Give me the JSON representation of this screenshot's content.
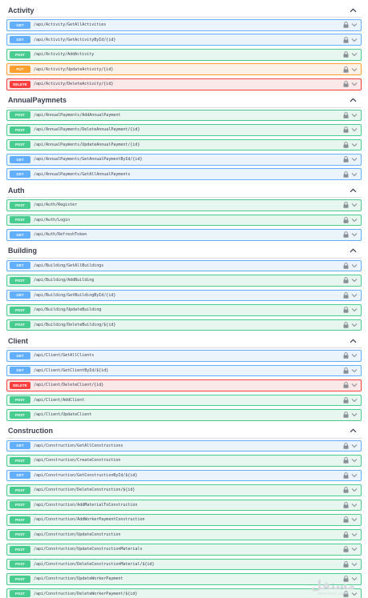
{
  "colors": {
    "get": "#61affe",
    "post": "#49cc90",
    "put": "#fca130",
    "delete": "#f93e3e"
  },
  "icons": {
    "lock": "lock-icon",
    "expand": "chevron-down-icon",
    "collapse": "chevron-up-icon"
  },
  "sections": [
    {
      "title": "Activity",
      "ops": [
        {
          "method": "GET",
          "path": "/api/Activity/GetAllActivities"
        },
        {
          "method": "GET",
          "path": "/api/Activity/GetActivityById/{id}"
        },
        {
          "method": "POST",
          "path": "/api/Activity/AddActivity"
        },
        {
          "method": "PUT",
          "path": "/api/Activity/UpdateActivity/{id}"
        },
        {
          "method": "DELETE",
          "path": "/api/Activity/DeleteActivity/{id}"
        }
      ]
    },
    {
      "title": "AnnualPaymnets",
      "ops": [
        {
          "method": "POST",
          "path": "/api/AnnualPayments/AddAnnualPayment"
        },
        {
          "method": "POST",
          "path": "/api/AnnualPayments/DeleteAnnualPayment/{id}"
        },
        {
          "method": "POST",
          "path": "/api/AnnualPayments/UpdateAnnualPayment/{id}"
        },
        {
          "method": "GET",
          "path": "/api/AnnualPayments/GetAnnualPaymentById/{id}"
        },
        {
          "method": "GET",
          "path": "/api/AnnualPayments/GetAllAnnualPayments"
        }
      ]
    },
    {
      "title": "Auth",
      "ops": [
        {
          "method": "POST",
          "path": "/api/Auth/Register"
        },
        {
          "method": "POST",
          "path": "/api/Auth/Login"
        },
        {
          "method": "GET",
          "path": "/api/Auth/RefreshToken"
        }
      ]
    },
    {
      "title": "Building",
      "ops": [
        {
          "method": "GET",
          "path": "/api/Building/GetAllBuildings"
        },
        {
          "method": "POST",
          "path": "/api/Building/AddBuilding"
        },
        {
          "method": "GET",
          "path": "/api/Building/GetBuildingById/{id}"
        },
        {
          "method": "POST",
          "path": "/api/Building/UpdateBuilding"
        },
        {
          "method": "POST",
          "path": "/api/Building/DeleteBuilding/${id}"
        }
      ]
    },
    {
      "title": "Client",
      "ops": [
        {
          "method": "GET",
          "path": "/api/Client/GetAllClients"
        },
        {
          "method": "GET",
          "path": "/api/Client/GetClientById/${id}"
        },
        {
          "method": "DELETE",
          "path": "/api/Client/DeleteClient/{id}"
        },
        {
          "method": "POST",
          "path": "/api/Client/AddClient"
        },
        {
          "method": "POST",
          "path": "/api/Client/UpdateClient"
        }
      ]
    },
    {
      "title": "Construction",
      "ops": [
        {
          "method": "GET",
          "path": "/api/Construction/GetAllConstructions"
        },
        {
          "method": "POST",
          "path": "/api/Construction/CreateConstruction"
        },
        {
          "method": "GET",
          "path": "/api/Construction/GetConstructionById/${id}"
        },
        {
          "method": "POST",
          "path": "/api/Construction/DeleteConstruction/${id}"
        },
        {
          "method": "POST",
          "path": "/api/Construction/AddMaterialToConstruction"
        },
        {
          "method": "POST",
          "path": "/api/Construction/AddWorkerPaymentConstruction"
        },
        {
          "method": "POST",
          "path": "/api/Construction/UpdateConstruction"
        },
        {
          "method": "POST",
          "path": "/api/Construction/UpdateConstructionMaterials"
        },
        {
          "method": "POST",
          "path": "/api/Construction/DeleteConstructionMaterial/${id}"
        },
        {
          "method": "POST",
          "path": "/api/Construction/UpdateWorkerPayment"
        },
        {
          "method": "POST",
          "path": "/api/Construction/DeleteWorkerPayment/${id}"
        }
      ]
    }
  ],
  "watermark": {
    "text": "مستقل",
    "sub": "mostaql.com"
  }
}
